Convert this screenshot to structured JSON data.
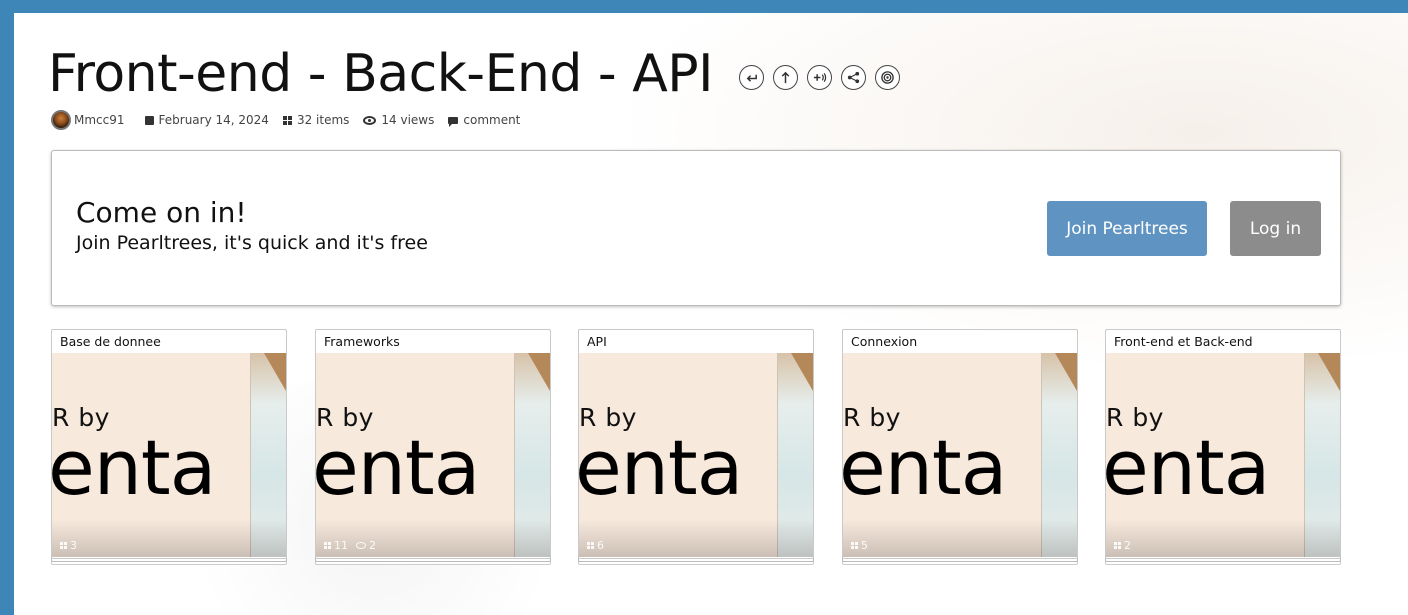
{
  "pearltree": {
    "title": "Front-end - Back-End - API",
    "author": "Mmcc91",
    "date": "February 14, 2024",
    "items": "32 items",
    "views": "14 views",
    "comment": "comment"
  },
  "toolbar": {
    "icons": [
      "back-icon",
      "up-icon",
      "add-icon",
      "share-icon",
      "target-icon"
    ]
  },
  "banner": {
    "heading": "Come on in!",
    "subheading": "Join Pearltrees, it's quick and it's free",
    "join_label": "Join Pearltrees",
    "login_label": "Log in",
    "join_color": "#5f93c2",
    "login_color": "#8c8c8c"
  },
  "cards": [
    {
      "title": "Base de donnee",
      "thumb_line1": "R by",
      "thumb_line2": "enta",
      "count": "3",
      "views": ""
    },
    {
      "title": "Frameworks",
      "thumb_line1": "R by",
      "thumb_line2": "enta",
      "count": "11",
      "views": "2"
    },
    {
      "title": "API",
      "thumb_line1": "R by",
      "thumb_line2": "enta",
      "count": "6",
      "views": ""
    },
    {
      "title": "Connexion",
      "thumb_line1": "R by",
      "thumb_line2": "enta",
      "count": "5",
      "views": ""
    },
    {
      "title": "Front-end et Back-end",
      "thumb_line1": "R by",
      "thumb_line2": "enta",
      "count": "2",
      "views": ""
    }
  ],
  "colors": {
    "frame": "#3f86b8",
    "thumb_bg": "#f8e9dd"
  }
}
